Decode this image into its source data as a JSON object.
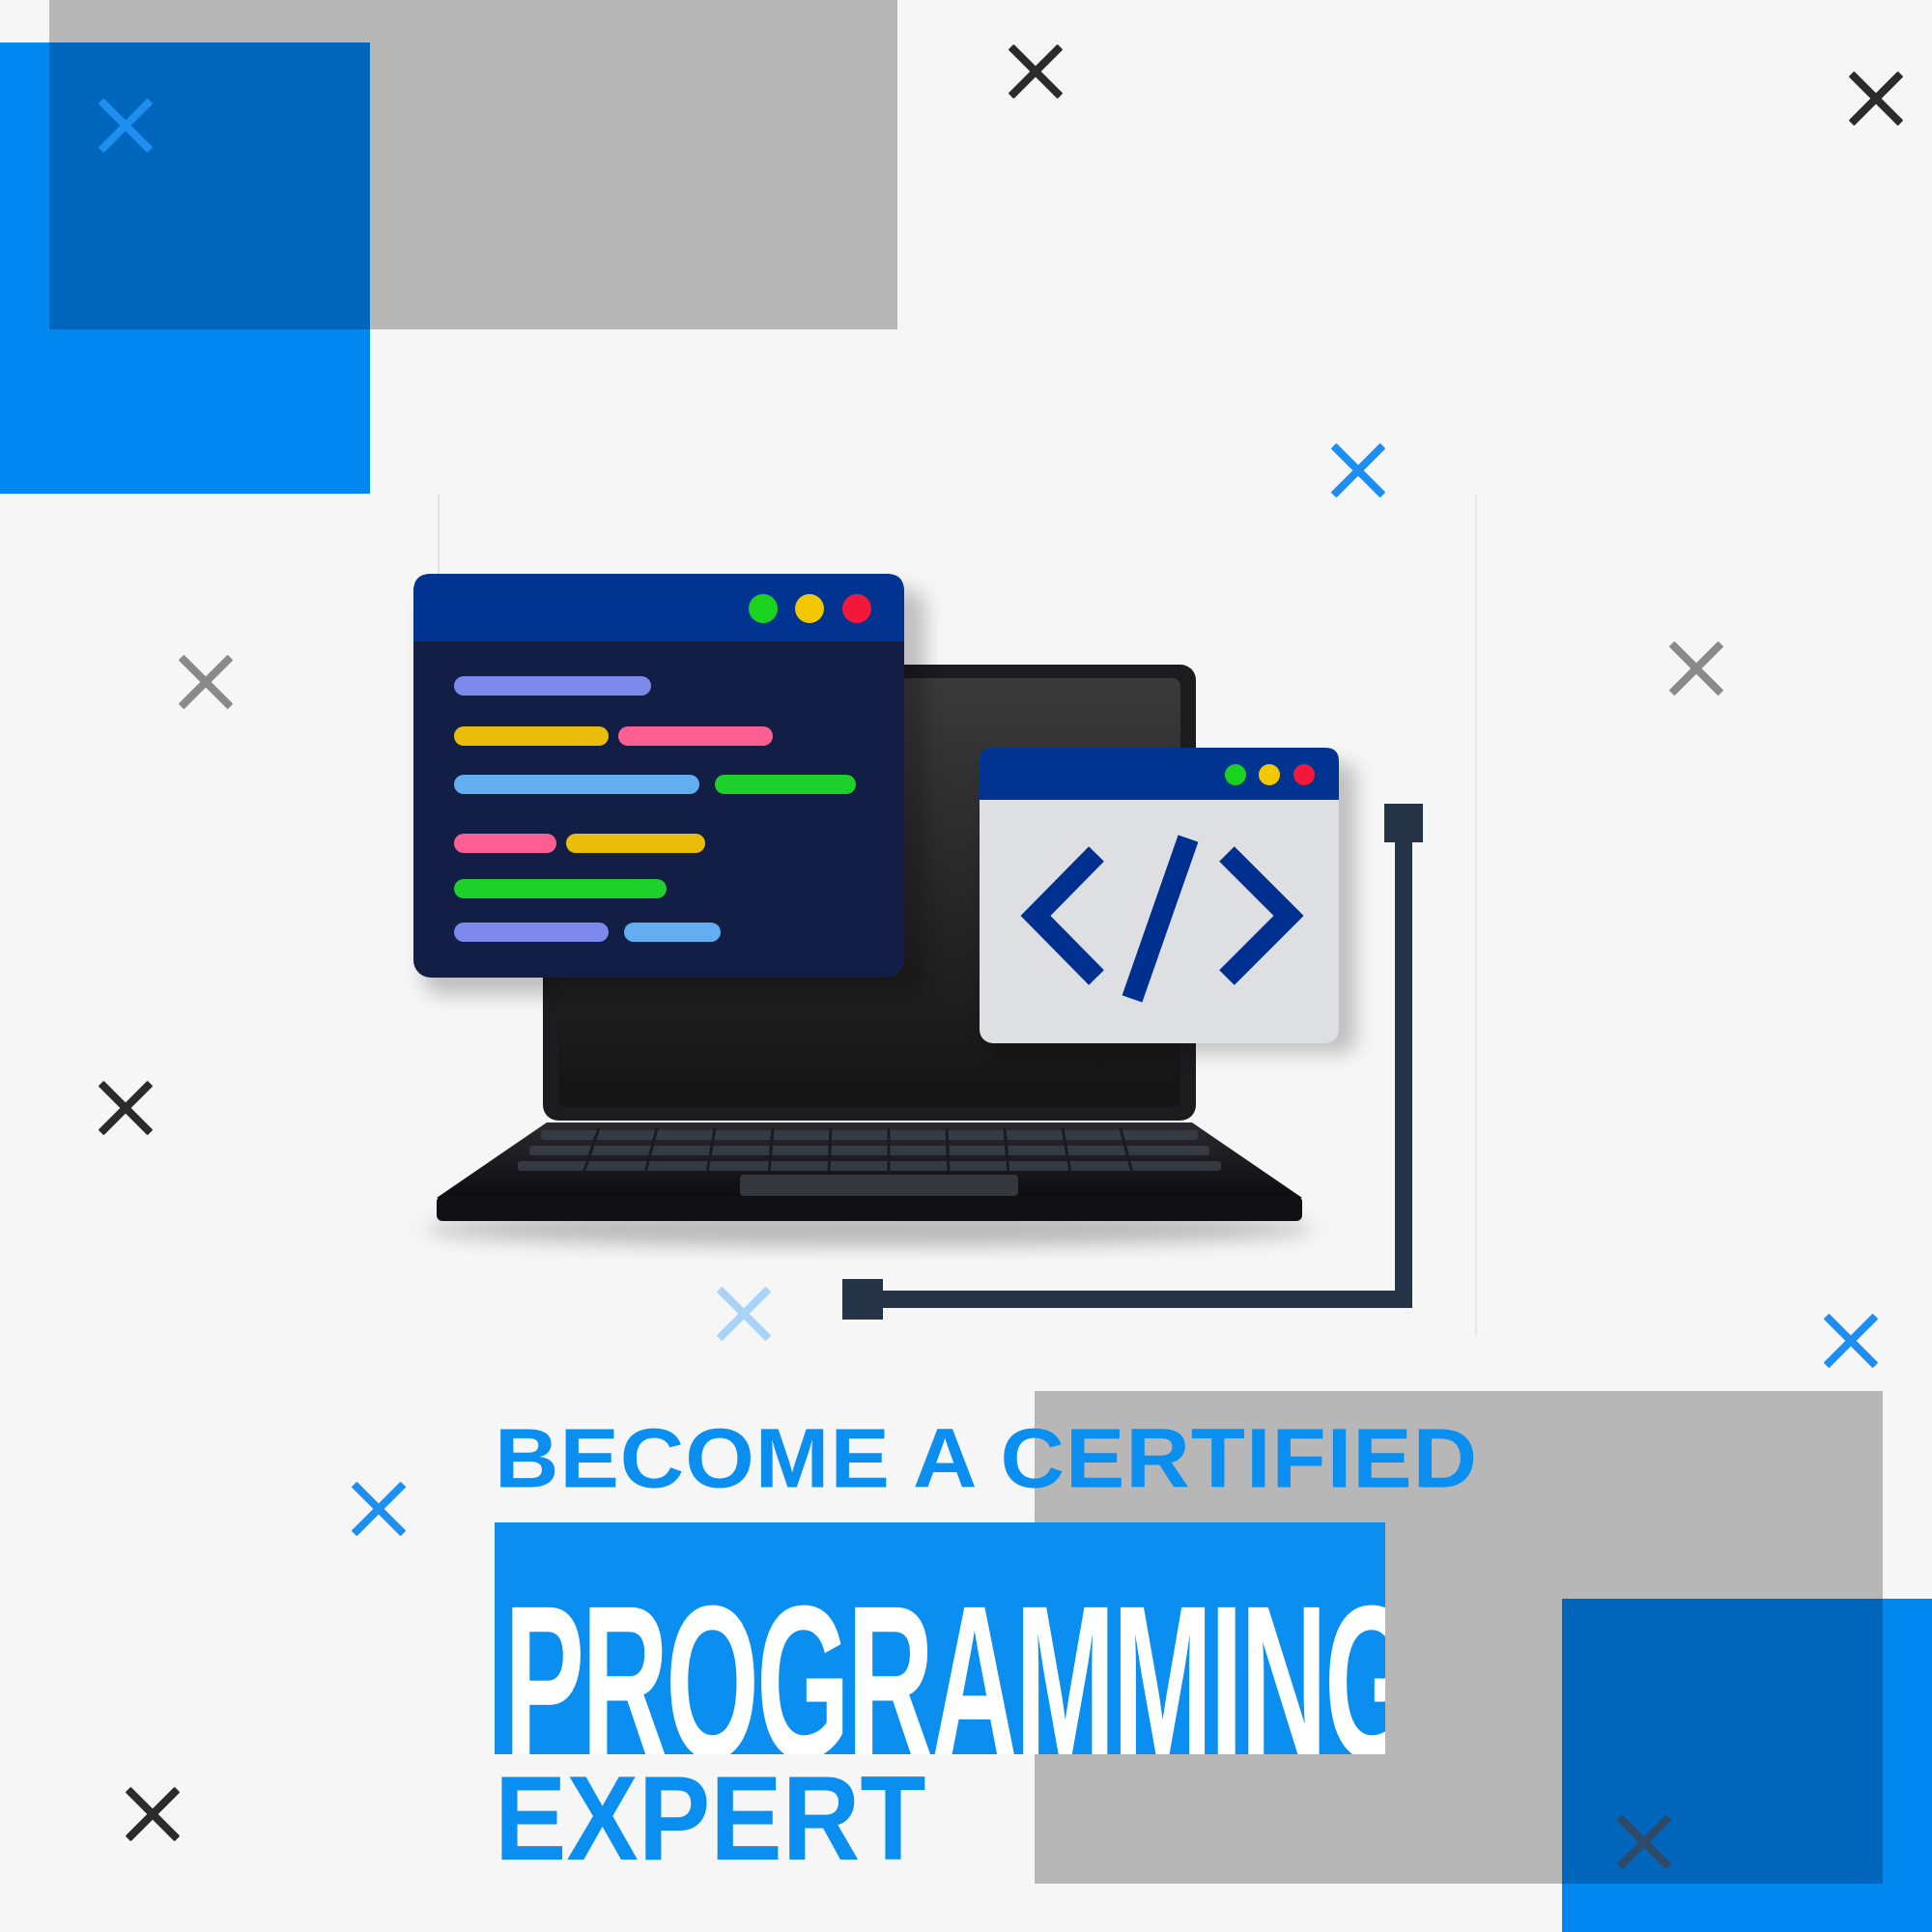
{
  "headline": {
    "line1": "BECOME A CERTIFIED",
    "line2": "PROGRAMMING",
    "line3": "EXPERT"
  },
  "colors": {
    "brand_blue": "#0a8ff0",
    "dark_blue": "#0066bb",
    "navy": "#003490",
    "gray_block": "#b7b7b7",
    "background": "#f6f6f6"
  },
  "illustration": {
    "code_window_lines": [
      "purple",
      "yellow",
      "pink",
      "light-blue",
      "green",
      "pink",
      "yellow",
      "green",
      "purple",
      "light-blue"
    ],
    "window_dots": [
      "green",
      "yellow",
      "red"
    ],
    "icons": [
      "code-tag-icon",
      "laptop-icon",
      "cross-icon"
    ]
  }
}
